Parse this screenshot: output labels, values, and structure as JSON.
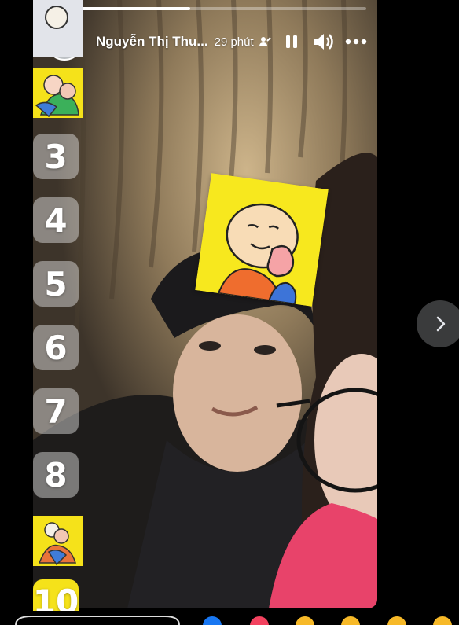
{
  "progress": {
    "fraction": 0.45
  },
  "header": {
    "user_name": "Nguyễn Thị Thu...",
    "time": "29 phút",
    "audience_icon": "friends-icon",
    "pause_icon": "pause-icon",
    "volume_icon": "volume-icon",
    "more_icon": "more-icon"
  },
  "strip": {
    "tiles": [
      "3",
      "4",
      "5",
      "6",
      "7",
      "8"
    ],
    "bottom_partial": "10"
  },
  "nav": {
    "next_icon": "chevron-right-icon"
  },
  "colors": {
    "sticker_yellow": "#f7e81e",
    "progress": "#ffffff",
    "nav_bg": "#3a3b3c"
  }
}
